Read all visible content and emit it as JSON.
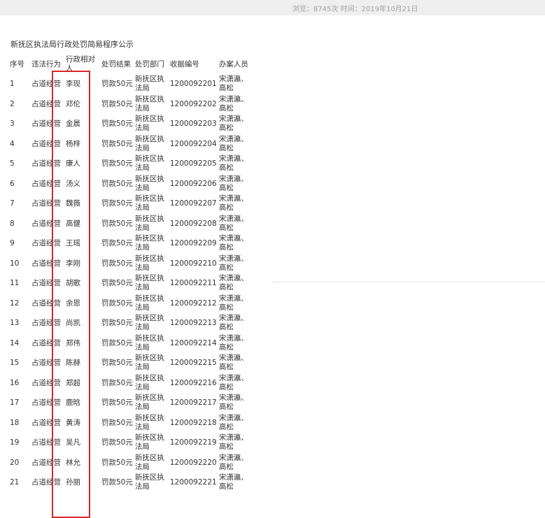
{
  "header": {
    "meta": "浏览：8745次 时间：2019年10月21日"
  },
  "title": "新抚区执法局行政处罚简易程序公示",
  "table": {
    "headers": [
      "序号",
      "违法行为",
      "行政相对人",
      "处罚结果",
      "处罚部门",
      "收据编号",
      "办案人员"
    ],
    "rows": [
      [
        "1",
        "占道经营",
        "李现",
        "罚款50元",
        "新抚区执法局",
        "1200092201",
        "宋潇瀛、高松"
      ],
      [
        "2",
        "占道经营",
        "邓伦",
        "罚款50元",
        "新抚区执法局",
        "1200092202",
        "宋潇瀛、高松"
      ],
      [
        "3",
        "占道经营",
        "金晨",
        "罚款50元",
        "新抚区执法局",
        "1200092203",
        "宋潇瀛、高松"
      ],
      [
        "4",
        "占道经营",
        "杨梓",
        "罚款50元",
        "新抚区执法局",
        "1200092204",
        "宋潇瀛、高松"
      ],
      [
        "5",
        "占道经营",
        "康人",
        "罚款50元",
        "新抚区执法局",
        "1200092205",
        "宋潇瀛、高松"
      ],
      [
        "6",
        "占道经营",
        "汤义",
        "罚款50元",
        "新抚区执法局",
        "1200092206",
        "宋潇瀛、高松"
      ],
      [
        "7",
        "占道经营",
        "魏薇",
        "罚款50元",
        "新抚区执法局",
        "1200092207",
        "宋潇瀛、高松"
      ],
      [
        "8",
        "占道经营",
        "高健",
        "罚款50元",
        "新抚区执法局",
        "1200092208",
        "宋潇瀛、高松"
      ],
      [
        "9",
        "占道经营",
        "王瑶",
        "罚款50元",
        "新抚区执法局",
        "1200092209",
        "宋潇瀛、高松"
      ],
      [
        "10",
        "占道经营",
        "李刚",
        "罚款50元",
        "新抚区执法局",
        "1200092210",
        "宋潇瀛、高松"
      ],
      [
        "11",
        "占道经营",
        "胡歌",
        "罚款50元",
        "新抚区执法局",
        "1200092211",
        "宋潇瀛、高松"
      ],
      [
        "12",
        "占道经营",
        "余恩",
        "罚款50元",
        "新抚区执法局",
        "1200092212",
        "宋潇瀛、高松"
      ],
      [
        "13",
        "占道经营",
        "尚凯",
        "罚款50元",
        "新抚区执法局",
        "1200092213",
        "宋潇瀛、高松"
      ],
      [
        "14",
        "占道经营",
        "郑伟",
        "罚款50元",
        "新抚区执法局",
        "1200092214",
        "宋潇瀛、高松"
      ],
      [
        "15",
        "占道经营",
        "陈赫",
        "罚款50元",
        "新抚区执法局",
        "1200092215",
        "宋潇瀛、高松"
      ],
      [
        "16",
        "占道经营",
        "郑超",
        "罚款50元",
        "新抚区执法局",
        "1200092216",
        "宋潇瀛、高松"
      ],
      [
        "17",
        "占道经营",
        "鹿晗",
        "罚款50元",
        "新抚区执法局",
        "1200092217",
        "宋潇瀛、高松"
      ],
      [
        "18",
        "占道经营",
        "黄涛",
        "罚款50元",
        "新抚区执法局",
        "1200092218",
        "宋潇瀛、高松"
      ],
      [
        "19",
        "占道经营",
        "吴凡",
        "罚款50元",
        "新抚区执法局",
        "1200092219",
        "宋潇瀛、高松"
      ],
      [
        "20",
        "占道经营",
        "林允",
        "罚款50元",
        "新抚区执法局",
        "1200092220",
        "宋潇瀛、高松"
      ],
      [
        "21",
        "占道经营",
        "孙丽",
        "罚款50元",
        "新抚区执法局",
        "1200092221",
        "宋潇瀛、高松"
      ]
    ]
  },
  "colors": {
    "highlight_border": "#d9262a",
    "topbar": "#efefef"
  }
}
